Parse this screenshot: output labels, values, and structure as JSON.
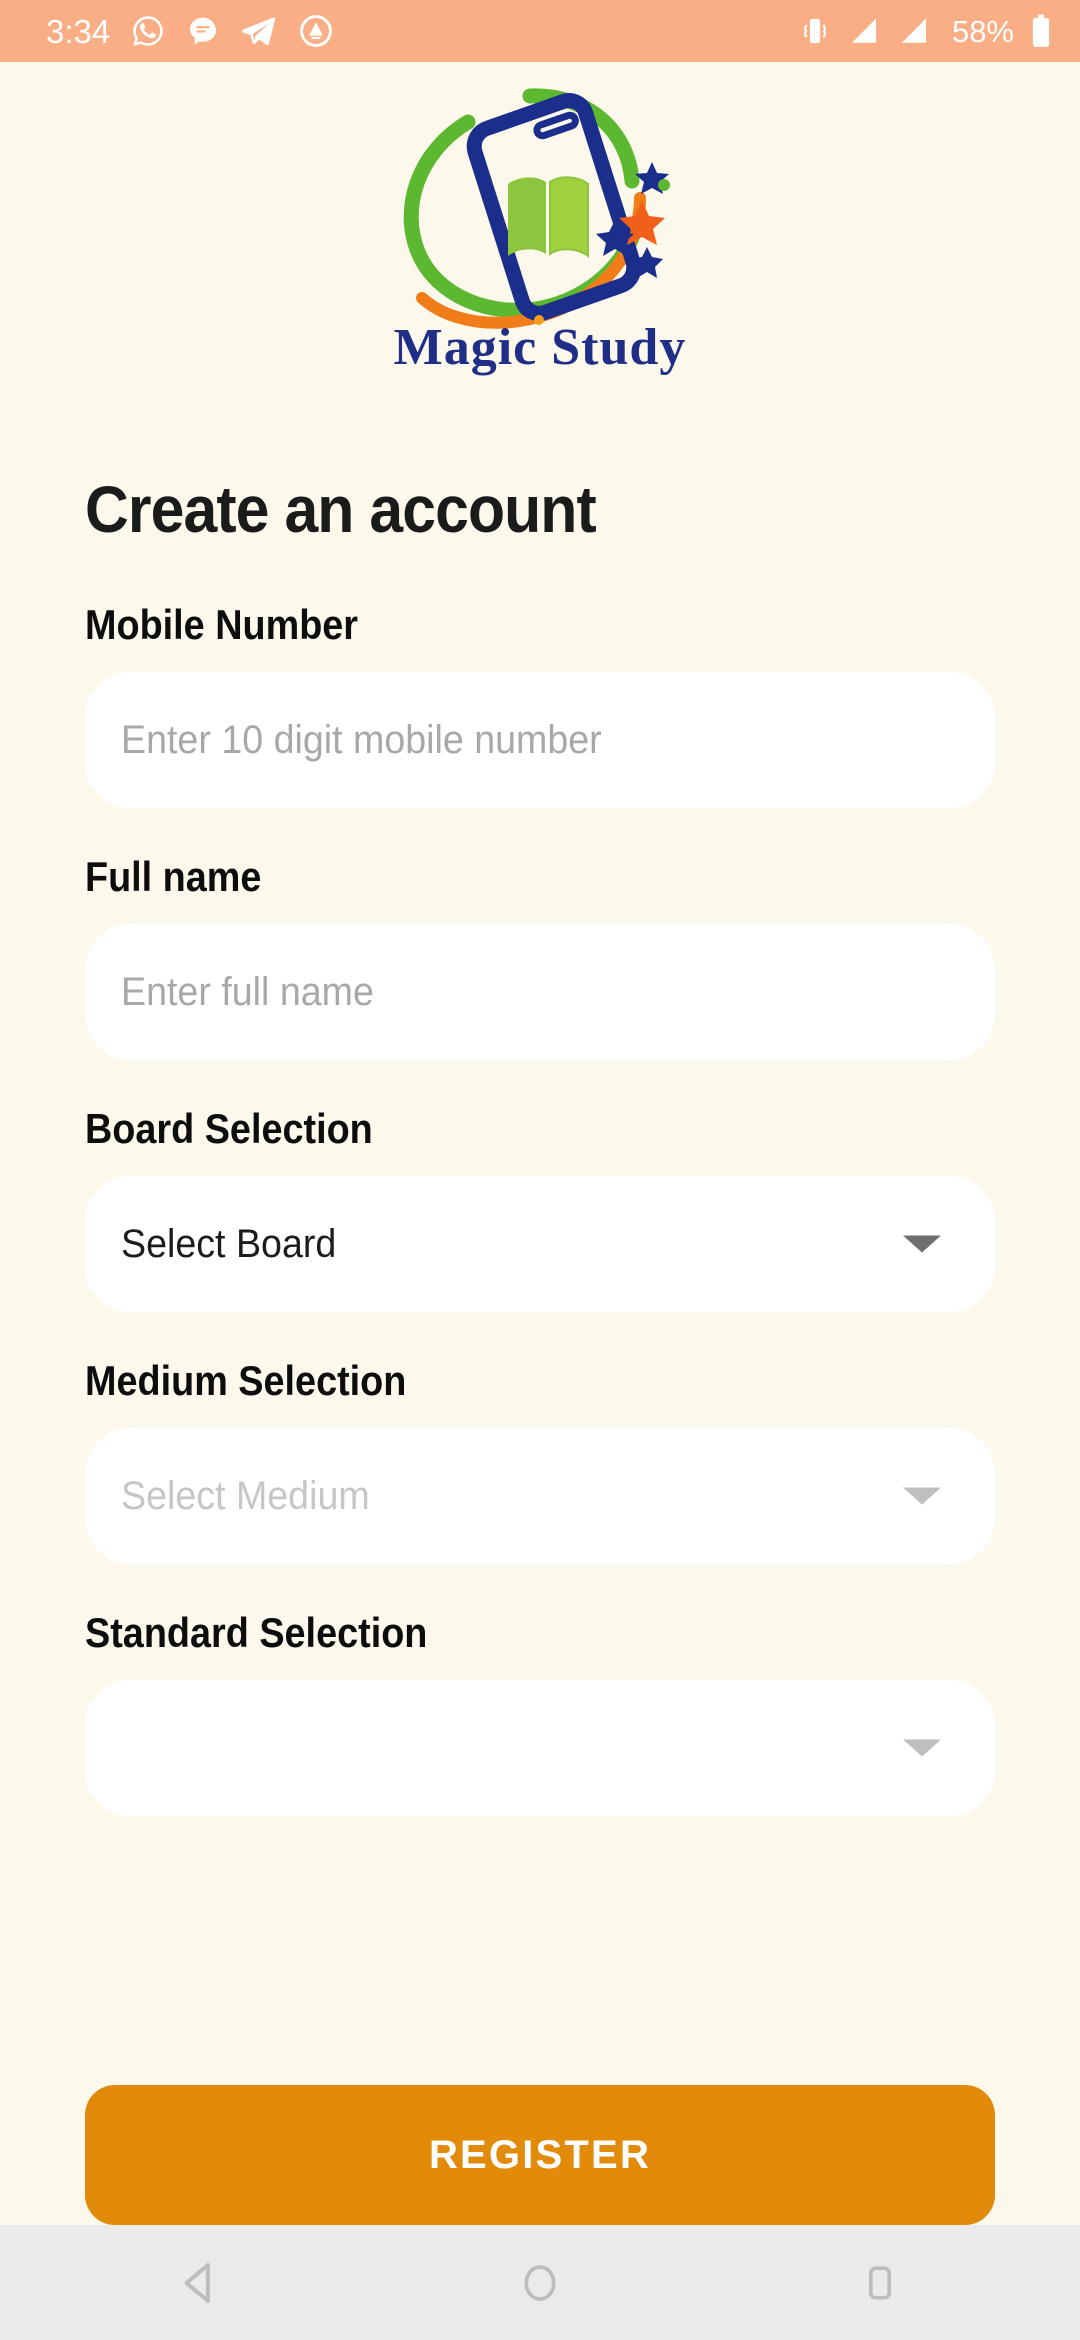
{
  "status_bar": {
    "time": "3:34",
    "battery_percent": "58%",
    "background_color": "#F9AE85",
    "icons": [
      "whatsapp-icon",
      "messages-icon",
      "telegram-icon",
      "app-circle-a-icon",
      "vibrate-icon",
      "signal-bars-icon-1",
      "signal-bars-icon-2",
      "battery-icon"
    ]
  },
  "logo": {
    "brand_name": "Magic Study",
    "brand_text_color": "#1F2E86",
    "phone_color": "#1B2E8C",
    "book_color": "#8CC63E",
    "swoosh_green": "#5CB831",
    "swoosh_orange": "#F07D1A",
    "star_blue": "#1B2E8C",
    "star_orange": "#F0601A"
  },
  "page": {
    "title": "Create an account",
    "background_color": "#FDF8EC"
  },
  "form": {
    "fields": [
      {
        "name": "mobile-number",
        "label": "Mobile Number",
        "type": "text",
        "value": "",
        "placeholder": "Enter 10 digit mobile number",
        "state": "placeholder"
      },
      {
        "name": "full-name",
        "label": "Full name",
        "type": "text",
        "value": "",
        "placeholder": "Enter full name",
        "state": "placeholder"
      },
      {
        "name": "board-selection",
        "label": "Board Selection",
        "type": "select",
        "value": "Select Board",
        "placeholder": "Select Board",
        "state": "value"
      },
      {
        "name": "medium-selection",
        "label": "Medium Selection",
        "type": "select",
        "value": "Select Medium",
        "placeholder": "Select Medium",
        "state": "faded"
      },
      {
        "name": "standard-selection",
        "label": "Standard Selection",
        "type": "select",
        "value": "",
        "placeholder": "",
        "state": "empty"
      }
    ]
  },
  "actions": {
    "register_label": "REGISTER",
    "register_color": "#E28A09",
    "register_text_color": "#FFFFFF"
  },
  "nav_bar": {
    "background_color": "#EAEAEA",
    "icon_color": "#BDBDBD",
    "buttons": [
      {
        "name": "back-button",
        "icon": "back-triangle-icon"
      },
      {
        "name": "home-button",
        "icon": "home-circle-icon"
      },
      {
        "name": "recents-button",
        "icon": "recents-square-icon"
      }
    ]
  }
}
